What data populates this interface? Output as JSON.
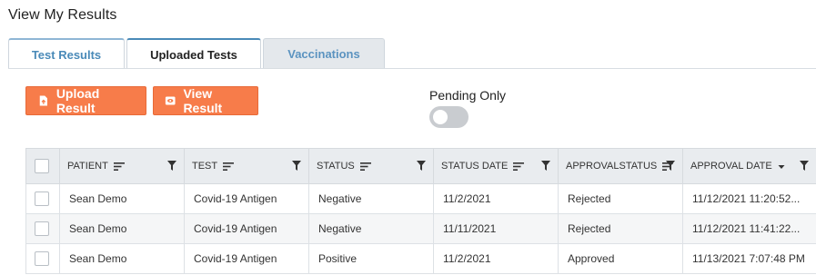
{
  "page": {
    "title": "View My Results"
  },
  "tabs": [
    {
      "label": "Test Results"
    },
    {
      "label": "Uploaded Tests"
    },
    {
      "label": "Vaccinations"
    }
  ],
  "toolbar": {
    "upload_label": "Upload Result",
    "view_label": "View Result",
    "pending_label": "Pending Only",
    "pending_on": false
  },
  "colors": {
    "accent": "#f77c4a",
    "tab_active_text": "#222222",
    "tab_link": "#4a8ab8"
  },
  "table": {
    "columns": [
      {
        "label": "PATIENT",
        "icon": "sort-lines-icon"
      },
      {
        "label": "TEST",
        "icon": "sort-lines-icon"
      },
      {
        "label": "STATUS",
        "icon": "sort-lines-icon"
      },
      {
        "label": "STATUS DATE",
        "icon": "sort-lines-icon"
      },
      {
        "label": "APPROVALSTATUS",
        "icon": "sort-lines-icon"
      },
      {
        "label": "APPROVAL DATE",
        "icon": "sort-desc-icon"
      }
    ],
    "rows": [
      [
        "Sean Demo",
        "Covid-19 Antigen",
        "Negative",
        "11/2/2021",
        "Rejected",
        "11/12/2021 11:20:52..."
      ],
      [
        "Sean Demo",
        "Covid-19 Antigen",
        "Negative",
        "11/11/2021",
        "Rejected",
        "11/12/2021 11:41:22..."
      ],
      [
        "Sean Demo",
        "Covid-19 Antigen",
        "Positive",
        "11/2/2021",
        "Approved",
        "11/13/2021 7:07:48 PM"
      ]
    ]
  }
}
